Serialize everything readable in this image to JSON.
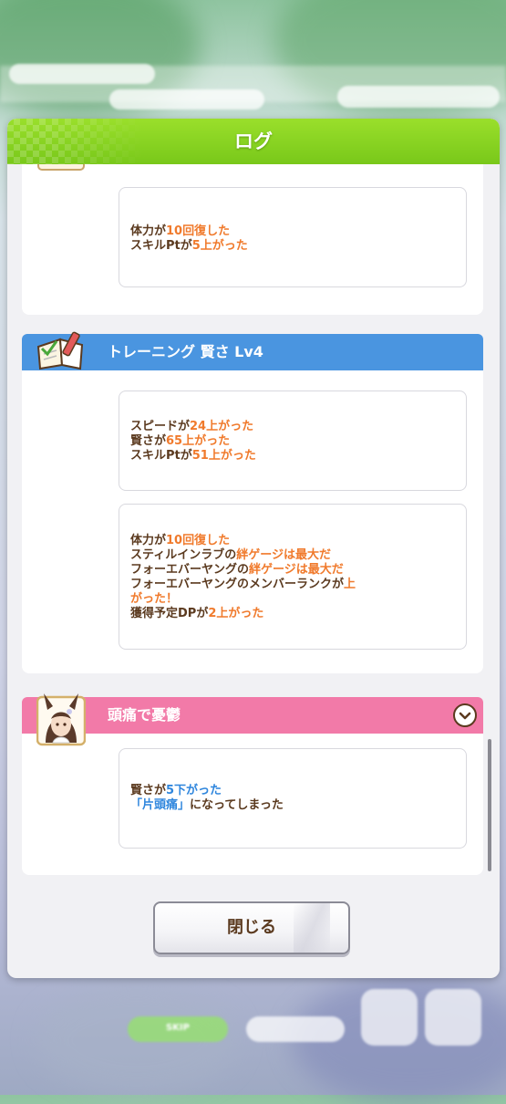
{
  "dialog": {
    "title": "ログ",
    "close_label": "閉じる"
  },
  "sections": [
    {
      "entries": [
        {
          "lines": [
            [
              {
                "t": "体力が"
              },
              {
                "t": "10回復した",
                "c": "o"
              }
            ],
            [
              {
                "t": "スキルPtが"
              },
              {
                "t": "5上がった",
                "c": "o"
              }
            ]
          ]
        }
      ]
    },
    {
      "title": "トレーニング 賢さ Lv4",
      "icon": "training-notebook-icon",
      "entries": [
        {
          "lines": [
            [
              {
                "t": "スピードが"
              },
              {
                "t": "24上がった",
                "c": "o"
              }
            ],
            [
              {
                "t": "賢さが"
              },
              {
                "t": "65上がった",
                "c": "o"
              }
            ],
            [
              {
                "t": "スキルPtが"
              },
              {
                "t": "51上がった",
                "c": "o"
              }
            ]
          ]
        },
        {
          "lines": [
            [
              {
                "t": "体力が"
              },
              {
                "t": "10回復した",
                "c": "o"
              }
            ],
            [
              {
                "t": "スティルインラブの"
              },
              {
                "t": "絆ゲージは最大だ",
                "c": "o"
              }
            ],
            [
              {
                "t": "フォーエバーヤングの"
              },
              {
                "t": "絆ゲージは最大だ",
                "c": "o"
              }
            ],
            [
              {
                "t": "フォーエバーヤングのメンバーランクが"
              },
              {
                "t": "上",
                "c": "o"
              }
            ],
            [
              {
                "t": "がった！",
                "c": "o"
              }
            ],
            [
              {
                "t": "獲得予定DPが"
              },
              {
                "t": "2上がった",
                "c": "o"
              }
            ]
          ]
        }
      ]
    },
    {
      "title": "頭痛で憂鬱",
      "icon": "character-portrait-icon",
      "entries": [
        {
          "lines": [
            [
              {
                "t": "賢さが"
              },
              {
                "t": "5下がった",
                "c": "b"
              }
            ],
            [
              {
                "t": "「片頭痛」",
                "c": "b"
              },
              {
                "t": "になってしまった"
              }
            ]
          ]
        }
      ]
    }
  ],
  "background_hud": {
    "bottom_skip_label": "SKIP",
    "colors": {
      "header_green": "#85d020",
      "training_blue": "#4a95e0",
      "event_pink": "#f27aa8",
      "up_orange": "#f07a2c",
      "down_blue": "#2f86dd",
      "text_brown": "#5b3a1f"
    }
  }
}
